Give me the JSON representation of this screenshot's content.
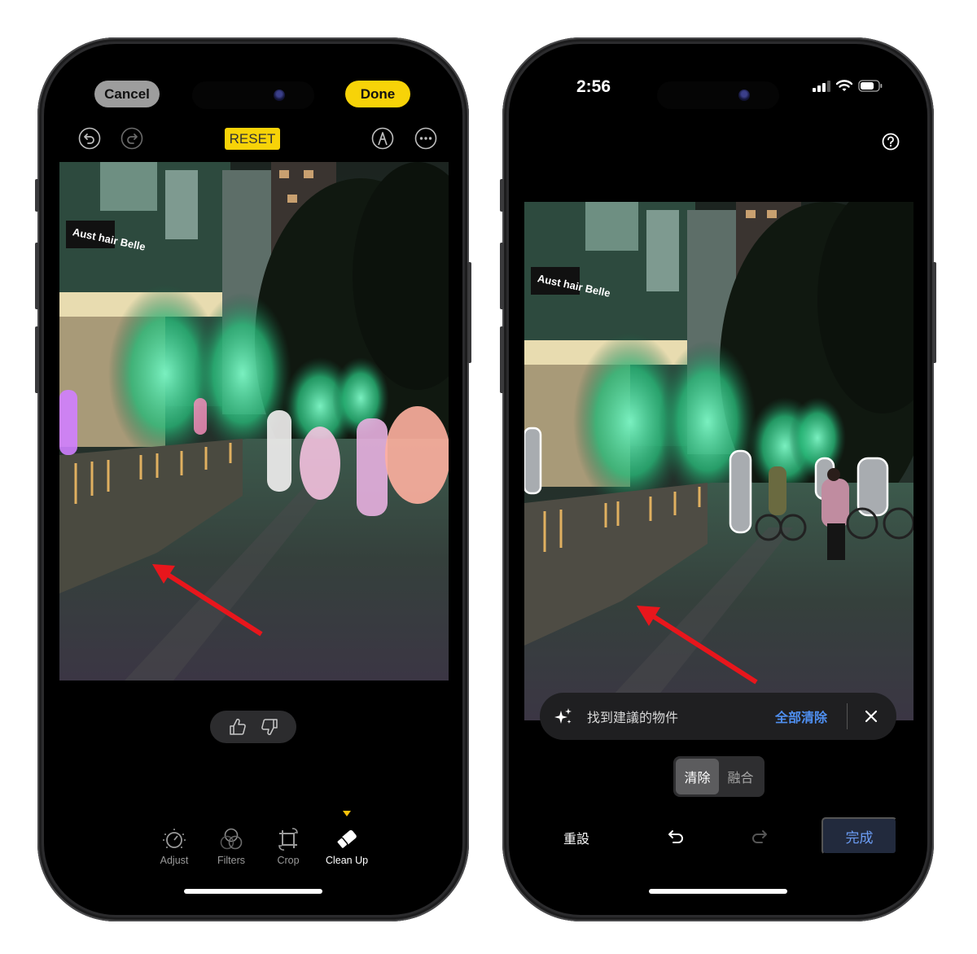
{
  "left_phone": {
    "header": {
      "cancel_label": "Cancel",
      "done_label": "Done",
      "reset_label": "RESET",
      "icons": [
        "undo-icon",
        "redo-icon",
        "markup-pen-icon",
        "more-icon"
      ]
    },
    "photo": {
      "description": "Night street with green-lit trees, brick planter wall, highlighted people to clean up",
      "storefront_sign": "Aust hair Belle",
      "annotation": "red arrow pointing at cleaned area near wall base"
    },
    "feedback": {
      "icons": [
        "thumbs-up-icon",
        "thumbs-down-icon"
      ]
    },
    "toolbar": {
      "tools": [
        {
          "label": "Adjust",
          "icon": "adjust-dial-icon",
          "active": false
        },
        {
          "label": "Filters",
          "icon": "filters-circles-icon",
          "active": false
        },
        {
          "label": "Crop",
          "icon": "crop-rotate-icon",
          "active": false
        },
        {
          "label": "Clean Up",
          "icon": "eraser-icon",
          "active": true
        }
      ]
    },
    "colors": {
      "accent": "#f7d308",
      "cancel_bg": "#9d9d9d"
    }
  },
  "right_phone": {
    "status_bar": {
      "time": "2:56",
      "icons": [
        "cellular-signal-icon",
        "wifi-icon",
        "battery-icon"
      ]
    },
    "help_icon": "question-circle-icon",
    "photo": {
      "description": "Same night street with suggested objects outlined in white",
      "storefront_sign": "Aust hair Belle",
      "annotation": "red arrow pointing at wall base"
    },
    "suggestion_bar": {
      "text": "找到建議的物件",
      "clear_all_label": "全部清除",
      "icons": [
        "sparkle-icon",
        "close-icon"
      ]
    },
    "mode_toggle": {
      "options": [
        "清除",
        "融合"
      ],
      "selected": "清除"
    },
    "bottom_bar": {
      "reset_label": "重設",
      "done_label": "完成",
      "icons": [
        "undo-icon",
        "redo-icon"
      ]
    },
    "colors": {
      "accent_blue": "#4f8ff0",
      "done_bg": "#222a3d"
    }
  }
}
